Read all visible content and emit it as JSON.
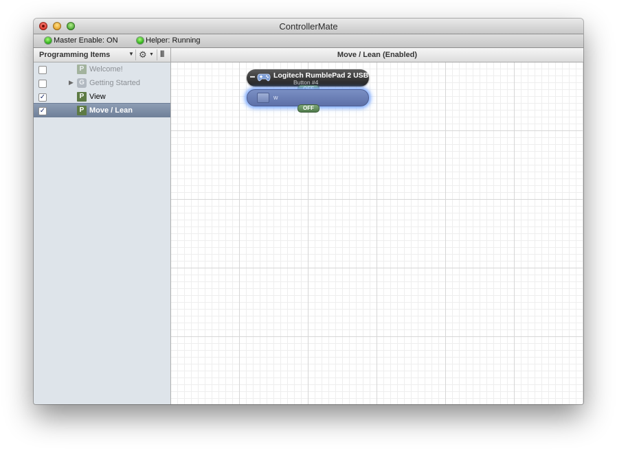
{
  "window": {
    "title": "ControllerMate"
  },
  "status": {
    "master": "Master Enable: ON",
    "helper": "Helper: Running",
    "led_color": "#26a613"
  },
  "sidebar": {
    "header_label": "Programming Items",
    "items": [
      {
        "label": "Welcome!",
        "badge": "P",
        "checked": false,
        "enabled": false,
        "selected": false
      },
      {
        "label": "Getting Started",
        "badge": "G",
        "checked": false,
        "enabled": false,
        "selected": false,
        "group": true
      },
      {
        "label": "View",
        "badge": "P",
        "checked": true,
        "enabled": true,
        "selected": false
      },
      {
        "label": "Move / Lean",
        "badge": "P",
        "checked": true,
        "enabled": true,
        "selected": true
      }
    ]
  },
  "canvas": {
    "header": "Move / Lean  (Enabled)",
    "device_node": {
      "name": "Logitech RumblePad 2 USB",
      "sub": "Button #4",
      "state": "OFF",
      "icon": "gamepad-icon"
    },
    "key_node": {
      "name": "w",
      "state": "OFF",
      "icon": "keyboard-key-icon",
      "glow_color": "#8ab2ff"
    }
  }
}
